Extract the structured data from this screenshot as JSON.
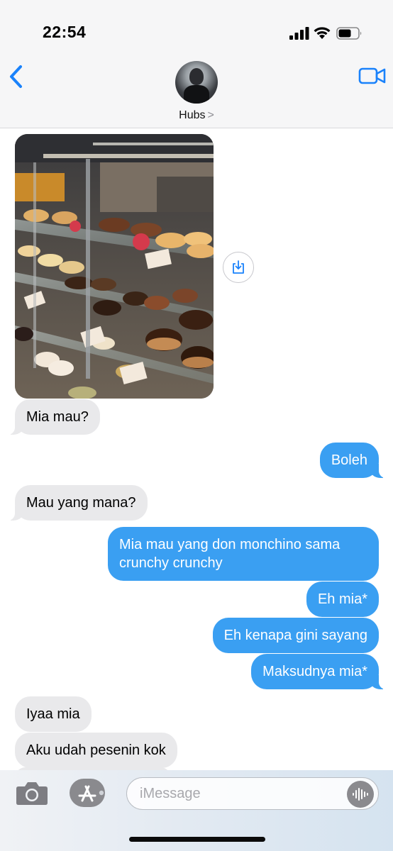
{
  "status_bar": {
    "time": "22:54"
  },
  "header": {
    "contact_name": "Hubs",
    "contact_chevron": ">"
  },
  "messages": [
    {
      "direction": "incoming",
      "text": "Mia mau?"
    },
    {
      "direction": "outgoing",
      "text": "Boleh"
    },
    {
      "direction": "incoming",
      "text": "Mau yang mana?"
    },
    {
      "direction": "outgoing",
      "text": "Mia mau yang don monchino sama crunchy crunchy"
    },
    {
      "direction": "outgoing",
      "text": "Eh mia*"
    },
    {
      "direction": "outgoing",
      "text": "Eh kenapa gini sayang"
    },
    {
      "direction": "outgoing",
      "text": "Maksudnya mia*"
    },
    {
      "direction": "incoming",
      "text": "Iyaa mia"
    },
    {
      "direction": "incoming",
      "text": "Aku udah pesenin kok"
    }
  ],
  "composer": {
    "placeholder": "iMessage"
  },
  "colors": {
    "outgoing_bubble": "#3a9ff2",
    "incoming_bubble": "#e9e9eb",
    "accent": "#1a82fb"
  },
  "icons": {
    "back": "chevron-left-icon",
    "video": "video-camera-icon",
    "save": "download-icon",
    "camera": "camera-icon",
    "apps": "app-store-icon",
    "audio": "audio-waveform-icon"
  }
}
